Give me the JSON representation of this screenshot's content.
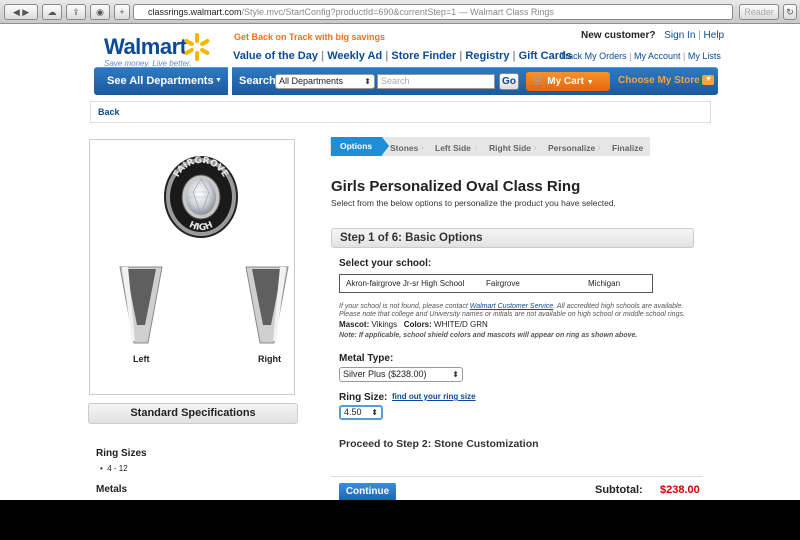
{
  "browser": {
    "url_domain": "classrings.walmart.com",
    "url_path": "/Style.mvc/StartConfig?productId=690&currentStep=1",
    "url_title": " — Walmart Class Rings",
    "reader_label": "Reader"
  },
  "header": {
    "logo_text": "Walmart",
    "tagline": "Save money. Live better.",
    "promo": "Get Back on Track with big savings",
    "new_customer": "New customer?",
    "sign_in": "Sign In",
    "help": "Help",
    "nav": [
      "Value of the Day",
      "Weekly Ad",
      "Store Finder",
      "Registry",
      "Gift Cards"
    ],
    "account_links": [
      "Track My Orders",
      "My Account",
      "My Lists"
    ]
  },
  "searchbar": {
    "departments_label": "See All Departments",
    "search_label": "Search",
    "dept_select": "All Departments",
    "search_placeholder": "Search",
    "go_label": "Go",
    "cart_label": "My Cart",
    "store_label": "Choose My Store"
  },
  "back_label": "Back",
  "preview": {
    "left_label": "Left",
    "right_label": "Right",
    "stone_text": "FAIRGROVE HIGH"
  },
  "specs": {
    "title": "Standard Specifications",
    "ring_sizes_label": "Ring Sizes",
    "ring_sizes_value": "4 - 12",
    "metals_label": "Metals"
  },
  "steps": [
    "Options",
    "Stones",
    "Left Side",
    "Right Side",
    "Personalize",
    "Finalize"
  ],
  "product": {
    "title": "Girls Personalized Oval Class Ring",
    "subtitle": "Select from the below options to personalize the product you have selected.",
    "step_header": "Step 1 of 6: Basic Options",
    "select_school_label": "Select your school:",
    "school_name": "Akron-fairgrove Jr-sr High School",
    "school_city": "Fairgrove",
    "school_state": "Michigan",
    "not_found_pre": "If your school is not found, please contact ",
    "not_found_link": "Walmart Customer Service",
    "not_found_post": ".   All accredited high schools are available.",
    "note_college": "Please note that college and University names or initials are not available on high school or middle school rings.",
    "mascot_label": "Mascot:",
    "mascot_value": "Vikings",
    "colors_label": "Colors:",
    "colors_value": "WHITE/D GRN",
    "note_shield": "Note: If applicable, school shield colors and mascots will appear on ring as shown above.",
    "metal_label": "Metal Type:",
    "metal_value": "Silver Plus ($238.00)",
    "ring_size_label": "Ring Size:",
    "ring_size_value": "4.50",
    "ring_size_link": "find out your ring size",
    "proceed_text": "Proceed to Step 2: Stone Customization",
    "continue_label": "Continue",
    "subtotal_label": "Subtotal:",
    "subtotal_value": "$238.00"
  },
  "colors": {
    "walmart_blue": "#0a4a97",
    "spark_yellow": "#f7b500",
    "accent_orange": "#f26f21",
    "step_active": "#1e8ed8",
    "price_red": "#cc0000"
  }
}
